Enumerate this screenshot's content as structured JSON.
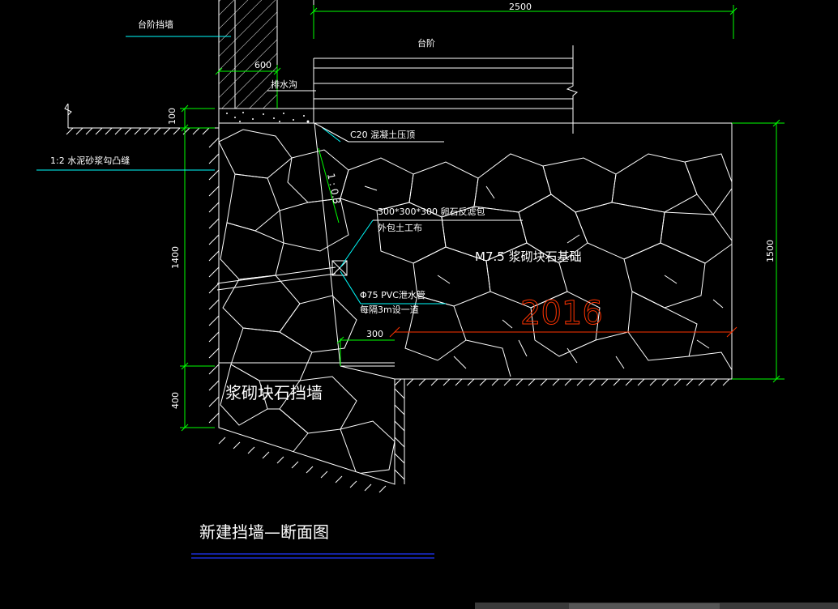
{
  "labels": {
    "step_retaining": "台阶挡墙",
    "step": "台阶",
    "drain_ditch": "排水沟",
    "mortar_joint": "1:2 水泥砂浆勾凸缝",
    "c20_cap": "C20 混凝土压顶",
    "slope": "1 : 0.3",
    "filter_pack_1": "300*300*300 卵石反滤包",
    "filter_pack_2": "外包土工布",
    "foundation": "M7.5 浆砌块石基础",
    "pvc_pipe_1": "Φ75 PVC泄水管",
    "pvc_pipe_2": "每隔3m设一道",
    "wall": "浆砌块石挡墙",
    "red_value": "2016",
    "title": "新建挡墙—断面图"
  },
  "dimensions": {
    "d2500": "2500",
    "d600": "600",
    "d100": "100",
    "d1400": "1400",
    "d400": "400",
    "d1500": "1500",
    "d300": "300"
  },
  "colors": {
    "background": "#000000",
    "line": "#ffffff",
    "dimension": "#00ff00",
    "leader": "#00ffff",
    "highlight": "#ff3300",
    "title_underline": "#1a2dd6"
  }
}
